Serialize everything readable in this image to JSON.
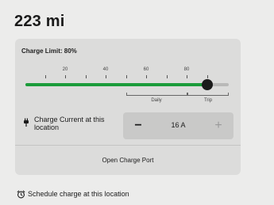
{
  "range": {
    "value": "223 mi"
  },
  "charge_limit": {
    "label": "Charge Limit: 80%",
    "percent": 80,
    "ticks": [
      "20",
      "40",
      "60",
      "80"
    ],
    "zones": {
      "daily": "Daily",
      "trip": "Trip"
    }
  },
  "charge_current": {
    "label": "Charge Current at this location",
    "value": "16 A",
    "minus_symbol": "−",
    "plus_symbol": "+"
  },
  "charge_port": {
    "button_label": "Open Charge Port"
  },
  "schedule": {
    "label": "Schedule charge at this location"
  },
  "colors": {
    "accent_green": "#1c9c3b",
    "panel_bg": "#dcdcdb",
    "page_bg": "#ececeb",
    "thumb": "#1b1b1b"
  },
  "icons": {
    "plug": "plug-icon",
    "clock": "alarm-clock-icon"
  }
}
